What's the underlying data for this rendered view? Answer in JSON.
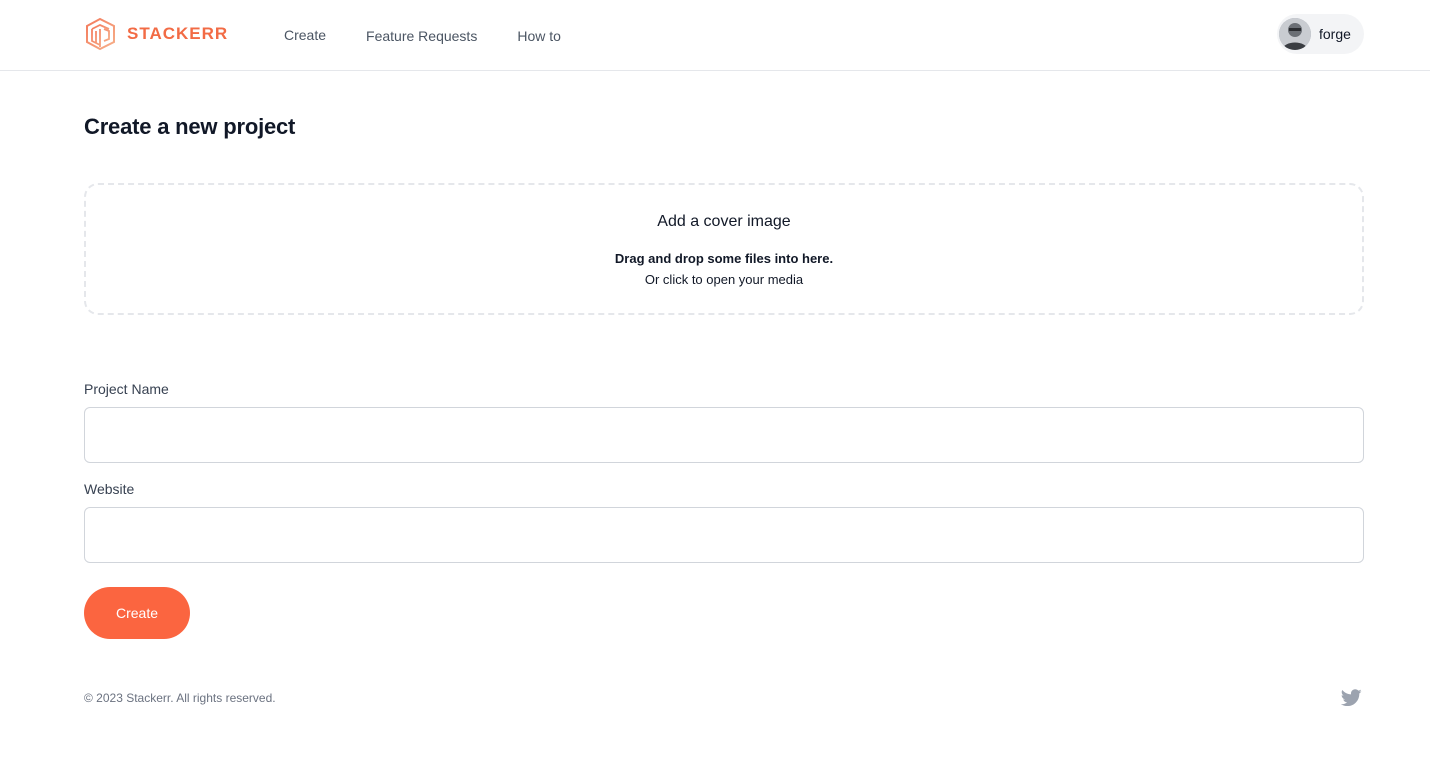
{
  "brand": {
    "name": "STACKERR",
    "accent": "#f26b45"
  },
  "nav": {
    "items": [
      {
        "label": "Create"
      },
      {
        "label": "Feature Requests"
      },
      {
        "label": "How to"
      }
    ]
  },
  "user": {
    "name": "forge",
    "avatar_icon": "user-avatar"
  },
  "main": {
    "title": "Create a new project",
    "dropzone": {
      "title": "Add a cover image",
      "line1": "Drag and drop some files into here.",
      "line2": "Or click to open your media"
    },
    "fields": [
      {
        "label": "Project Name",
        "value": "",
        "placeholder": ""
      },
      {
        "label": "Website",
        "value": "",
        "placeholder": ""
      }
    ],
    "submit_label": "Create",
    "button_color": "#fb6540"
  },
  "footer": {
    "copyright": "© 2023 Stackerr. All rights reserved.",
    "social_icon": "twitter-icon"
  }
}
